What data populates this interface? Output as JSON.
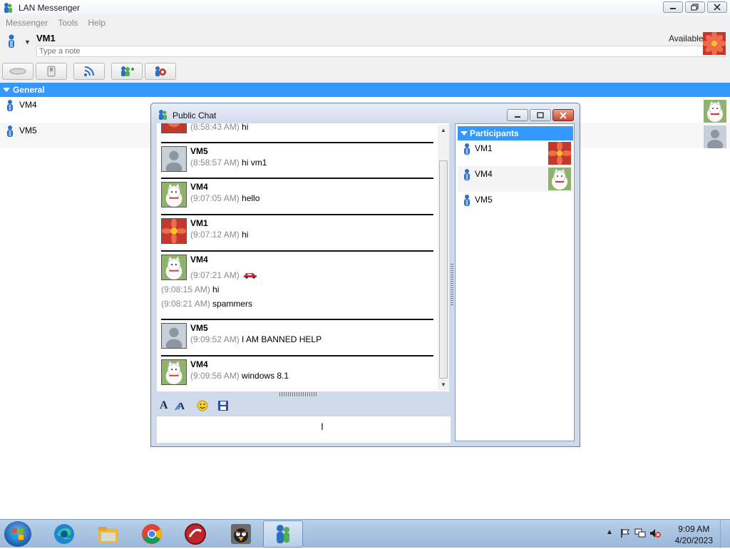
{
  "app": {
    "title": "LAN Messenger",
    "menus": [
      "Messenger",
      "Tools",
      "Help"
    ],
    "user_name": "VM1",
    "note_placeholder": "Type a note",
    "status": "Available"
  },
  "contacts": {
    "group": "General",
    "items": [
      {
        "name": "VM4"
      },
      {
        "name": "VM5"
      }
    ]
  },
  "chat": {
    "title": "Public Chat",
    "messages": [
      {
        "sender": "",
        "time": "(8:58:43 AM)",
        "text": "hi"
      },
      {
        "sender": "VM5",
        "time": "(8:58:57 AM)",
        "text": "hi vm1"
      },
      {
        "sender": "VM4",
        "time": "(9:07:05 AM)",
        "text": "hello"
      },
      {
        "sender": "VM1",
        "time": "(9:07:12 AM)",
        "text": "hi"
      },
      {
        "sender": "VM4",
        "time": "(9:07:21 AM)",
        "text": "",
        "cont": [
          {
            "time": "(9:08:15 AM)",
            "text": "hi"
          },
          {
            "time": "(9:08:21 AM)",
            "text": "spammers"
          }
        ]
      },
      {
        "sender": "VM5",
        "time": "(9:09:52 AM)",
        "text": "I AM BANNED HELP"
      },
      {
        "sender": "VM4",
        "time": "(9:09:56 AM)",
        "text": "windows 8.1"
      }
    ],
    "participants_title": "Participants",
    "participants": [
      {
        "name": "VM1"
      },
      {
        "name": "VM4"
      },
      {
        "name": "VM5"
      }
    ]
  },
  "taskbar": {
    "time": "9:09 AM",
    "date": "4/20/2023"
  },
  "icons": {
    "title_bar": "messenger-icon",
    "toolbar": [
      "conversation-icon",
      "file-transfer-icon",
      "broadcast-icon",
      "add-contact-icon",
      "settings-icon"
    ]
  },
  "colors": {
    "accent": "#3399ff"
  }
}
